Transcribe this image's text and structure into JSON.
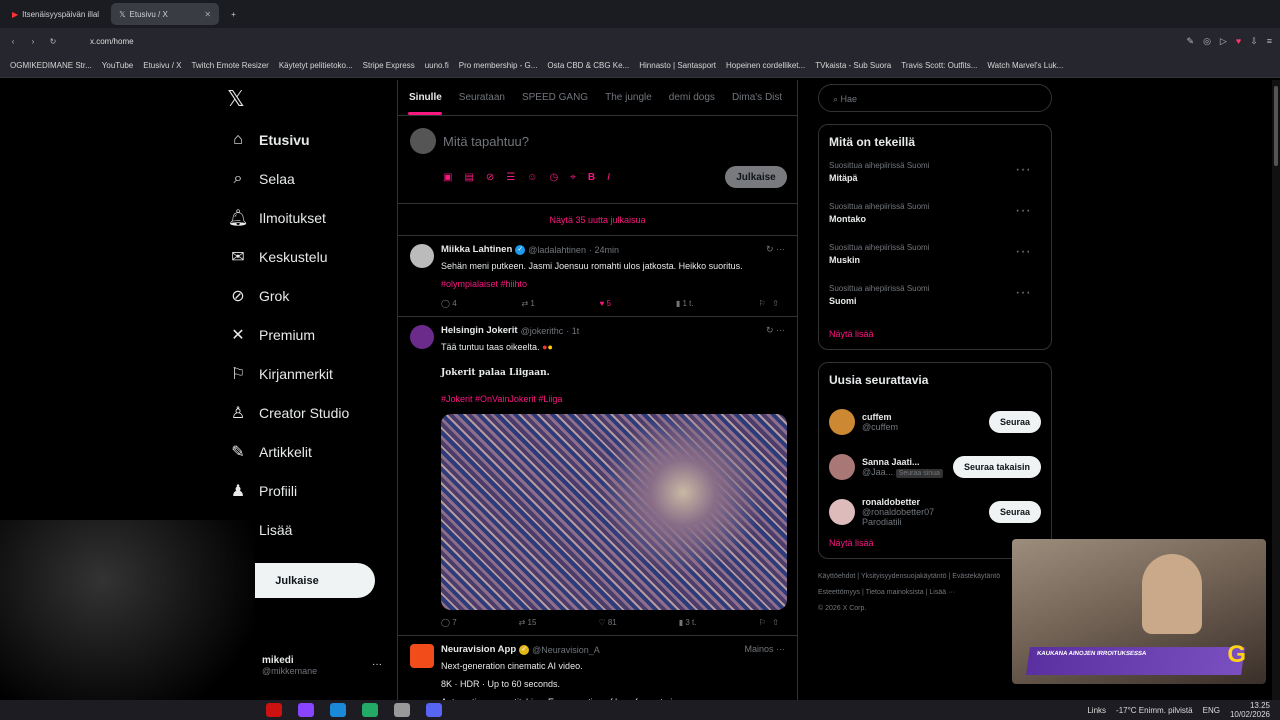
{
  "browser": {
    "tabs": [
      {
        "title": "Itsenäisyyspäivän illal"
      },
      {
        "title": "Etusivu / X"
      }
    ],
    "url": "x.com/home",
    "bookmarks": [
      "OGMIKEDIMANE Str...",
      "YouTube",
      "Etusivu / X",
      "Twitch Emote Resizer",
      "Käytetyt pelitietoko...",
      "Stripe Express",
      "uuno.fi",
      "Pro membership - G...",
      "Osta CBD & CBG Ke...",
      "Hinnasto | Santasport",
      "Hopeinen cordelliket...",
      "TVkaista - Sub Suora",
      "Travis Scott: Outfits...",
      "Watch Marvel's Luk..."
    ]
  },
  "sidebar": {
    "items": [
      {
        "label": "Etusivu",
        "icon": "home-icon"
      },
      {
        "label": "Selaa",
        "icon": "search-icon"
      },
      {
        "label": "Ilmoitukset",
        "icon": "bell-icon"
      },
      {
        "label": "Keskustelu",
        "icon": "mail-icon"
      },
      {
        "label": "Grok",
        "icon": "grok-icon"
      },
      {
        "label": "Premium",
        "icon": "x-icon"
      },
      {
        "label": "Kirjanmerkit",
        "icon": "bookmark-icon"
      },
      {
        "label": "Creator Studio",
        "icon": "creator-icon"
      },
      {
        "label": "Artikkelit",
        "icon": "article-icon"
      },
      {
        "label": "Profiili",
        "icon": "person-icon"
      },
      {
        "label": "Lisää",
        "icon": "more-icon"
      }
    ],
    "post_button": "Julkaise",
    "account_name": "mikedi",
    "account_handle": "@mikkemane"
  },
  "feed": {
    "tabs": [
      "Sinulle",
      "Seurataan",
      "SPEED GANG",
      "The jungle",
      "demi dogs",
      "Dima's Dist"
    ],
    "compose_placeholder": "Mitä tapahtuu?",
    "compose_button": "Julkaise",
    "show_new": "Näytä 35 uutta julkaisua",
    "tweets": [
      {
        "name": "Miikka Lahtinen",
        "handle": "@ladalahtinen",
        "time": "· 24min",
        "text": "Sehän meni putkeen. Jasmi Joensuu romahti ulos jatkosta. Heikko suoritus.",
        "tags": "#olympialaiset #hiihto",
        "replies": "4",
        "retweets": "1",
        "likes": "5",
        "views": "1 t."
      },
      {
        "name": "Helsingin Jokerit",
        "handle": "@jokerithc",
        "time": "· 1t",
        "text": "Tää tuntuu taas oikeelta.",
        "subtext": "Jokerit palaa Liigaan.",
        "tags": "#Jokerit #OnVainJokerit #Liiga",
        "replies": "7",
        "retweets": "15",
        "likes": "81",
        "views": "3 t."
      },
      {
        "name": "Neuravision App",
        "handle": "@Neuravision_A",
        "time": "Mainos",
        "text1": "Next-generation cinematic AI video.",
        "text2": "8K · HDR · Up to 60 seconds.",
        "text3": "Automatic scene stitching. Easy creation of long-form stories."
      }
    ]
  },
  "right": {
    "search_placeholder": "Hae",
    "trends_title": "Mitä on tekeillä",
    "trends": [
      {
        "context": "Suosittua aihepiirissä Suomi",
        "name": "Mitäpä"
      },
      {
        "context": "Suosittua aihepiirissä Suomi",
        "name": "Montako"
      },
      {
        "context": "Suosittua aihepiirissä Suomi",
        "name": "Muskin"
      },
      {
        "context": "Suosittua aihepiirissä Suomi",
        "name": "Suomi"
      }
    ],
    "show_more": "Näytä lisää",
    "who_title": "Uusia seurattavia",
    "who": [
      {
        "name": "cuffem",
        "handle": "@cuffem",
        "button": "Seuraa"
      },
      {
        "name": "Sanna Jaati...",
        "handle": "@Jaa...",
        "badge": "Seuraa sinua",
        "button": "Seuraa takaisin"
      },
      {
        "name": "ronaldobetter",
        "handle": "@ronaldobetter07",
        "badge": "Parodiatili",
        "button": "Seuraa"
      }
    ],
    "who_more": "Näytä lisää",
    "footer1": "Käyttöehdot  |  Yksityisyydensuojakäytäntö  |  Evästekäytäntö",
    "footer2": "Esteettömyys  |  Tietoa mainoksista  |  Lisää ···",
    "footer3": "© 2026 X Corp."
  },
  "overlay": {
    "banner": "KAUKANA AINOJEN IRROITUKSESSA"
  },
  "taskbar": {
    "links": "Links",
    "weather": "-17°C  Enimm. pilvistä",
    "lang": "ENG",
    "time": "13.25",
    "date": "10/02/2026"
  }
}
